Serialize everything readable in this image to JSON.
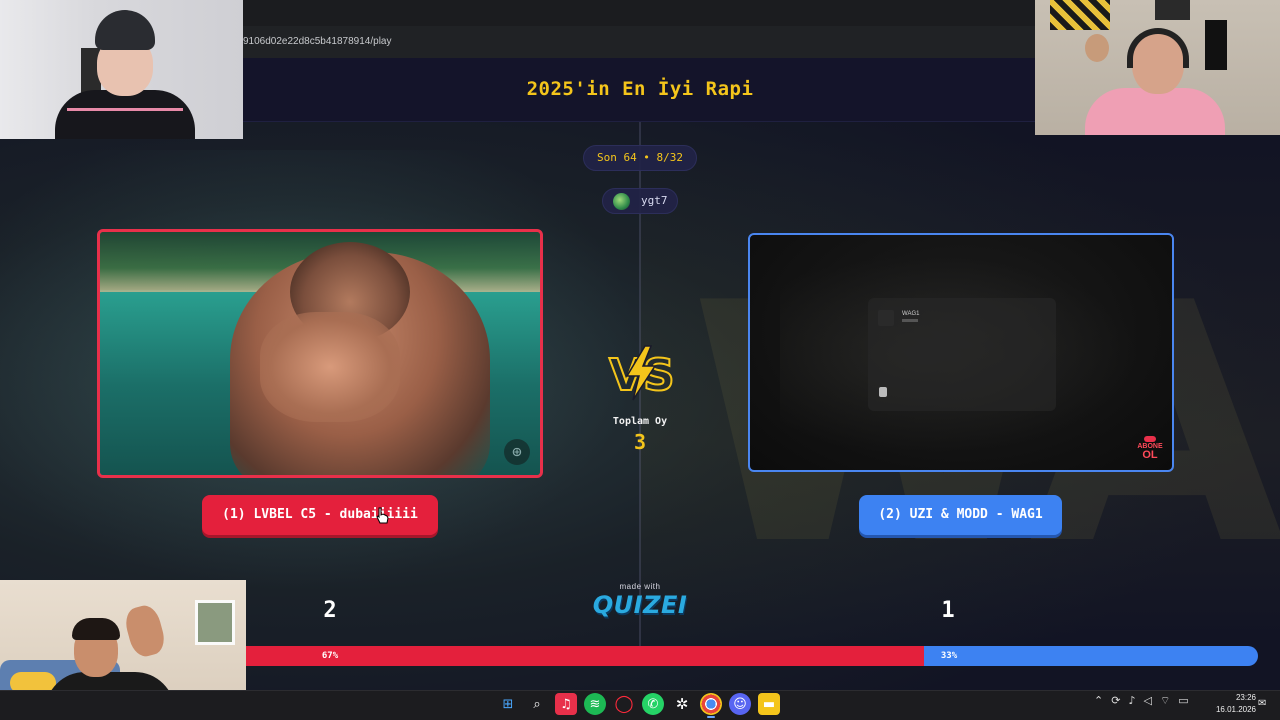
{
  "browser": {
    "url": "9106d02e22d8c5b41878914/play"
  },
  "header": {
    "title": "2025'in En İyi Rapi"
  },
  "round": {
    "label": "Son 64 • 8/32"
  },
  "user": {
    "name": "ygt7"
  },
  "left_option": {
    "label": "(1) LVBEL C5 - dubaiiiiii",
    "votes": "2",
    "percent": "67%",
    "share": 0.67,
    "color": "#e4203c"
  },
  "right_option": {
    "label": "(2) UZI & MODD - WAG1",
    "votes": "1",
    "percent": "33%",
    "share": 0.33,
    "color": "#3d82f2",
    "embed_title": "WAG1",
    "subscribe_line1": "ABONE",
    "subscribe_line2": "OL"
  },
  "center": {
    "vs_text": "VS",
    "total_label": "Toplam Oy",
    "total_value": "3",
    "made_with": "made with",
    "brand": "QUIZEI"
  },
  "taskbar": {
    "icons": [
      "windows-start-icon",
      "search-icon",
      "music-icon",
      "spotify-icon",
      "opera-icon",
      "whatsapp-icon",
      "chatgpt-icon",
      "chrome-icon",
      "discord-icon",
      "file-explorer-icon"
    ],
    "time": "23:26",
    "date": "16.01.2026"
  },
  "colors": {
    "accent_yellow": "#f4c51b",
    "panel_bg": "#14142a"
  }
}
